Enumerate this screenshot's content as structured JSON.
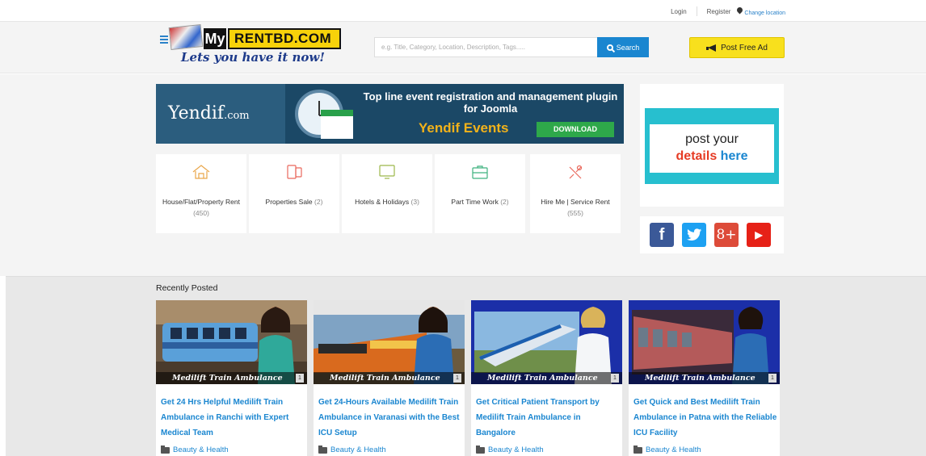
{
  "topbar": {
    "login": "Login",
    "register": "Register",
    "change_location": "Change location"
  },
  "header": {
    "logo_my": "My",
    "logo_rent": "RENTBD.COM",
    "logo_tagline": "Lets you have it now!",
    "search_placeholder": "e.g. Title, Category, Location, Description, Tags.....",
    "search_button": "Search",
    "post_ad": "Post Free Ad"
  },
  "banner": {
    "brand": "Yendif",
    "brand_suffix": ".com",
    "headline": "Top line event registration and management plugin for Joomla",
    "product": "Yendif Events",
    "cta": "DOWNLOAD"
  },
  "categories": [
    {
      "label": "House/Flat/Property Rent",
      "count": "(450)",
      "icon": "house-icon",
      "color": "#e9a64a"
    },
    {
      "label": "Properties Sale",
      "count": "(2)",
      "icon": "devices-icon",
      "color": "#e9685c"
    },
    {
      "label": "Hotels & Holidays",
      "count": "(3)",
      "icon": "monitor-icon",
      "color": "#9cb84a"
    },
    {
      "label": "Part Time Work",
      "count": "(2)",
      "icon": "briefcase-icon",
      "color": "#3fb27f"
    },
    {
      "label": "Hire Me | Service Rent",
      "count": "(555)",
      "icon": "tools-icon",
      "color": "#e9685c"
    }
  ],
  "side_ad": {
    "line1": "post your",
    "line2a": "details",
    "line2b": "here"
  },
  "social": [
    {
      "name": "facebook-icon",
      "glyph": "f",
      "color": "#3b5998"
    },
    {
      "name": "twitter-icon",
      "glyph": "t",
      "color": "#1da1f2"
    },
    {
      "name": "google-plus-icon",
      "glyph": "8+",
      "color": "#dd4b39"
    },
    {
      "name": "youtube-icon",
      "glyph": "▶",
      "color": "#e62117"
    }
  ],
  "recent": {
    "title": "Recently Posted",
    "cards": [
      {
        "caption": "Medilift Train Ambulance",
        "photos": "1",
        "title": "Get 24 Hrs Helpful Medilift Train Ambulance in Ranchi with Expert Medical Team",
        "category": "Beauty & Health"
      },
      {
        "caption": "Medilift Train Ambulance",
        "photos": "1",
        "title": "Get 24-Hours Available Medilift Train Ambulance in Varanasi with the Best ICU Setup",
        "category": "Beauty & Health"
      },
      {
        "caption": "Medilift Train Ambulance",
        "photos": "1",
        "title": "Get Critical Patient Transport by Medilift Train Ambulance in Bangalore",
        "category": "Beauty & Health"
      },
      {
        "caption": "Medilift Train Ambulance",
        "photos": "1",
        "title": "Get Quick and Best Medilift Train Ambulance in Patna with the Reliable ICU Facility",
        "category": "Beauty & Health"
      }
    ]
  }
}
